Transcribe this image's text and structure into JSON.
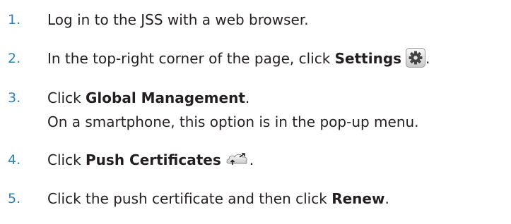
{
  "steps": [
    {
      "number": "1.",
      "text": "Log in to the JSS with a web browser."
    },
    {
      "number": "2.",
      "pre": "In the top-right corner of the page, click ",
      "bold": "Settings",
      "icon": "settings-gear-icon",
      "post": "."
    },
    {
      "number": "3.",
      "pre": "Click ",
      "bold": "Global Management",
      "post": ".",
      "note": "On a smartphone, this option is in the pop-up menu."
    },
    {
      "number": "4.",
      "pre": "Click ",
      "bold": "Push Certificates",
      "icon": "push-certificates-cloud-icon",
      "post": "."
    },
    {
      "number": "5.",
      "pre": "Click the push certificate and then click ",
      "bold": "Renew",
      "post": "."
    }
  ],
  "colors": {
    "number": "#2c83b8",
    "text": "#231f20"
  }
}
